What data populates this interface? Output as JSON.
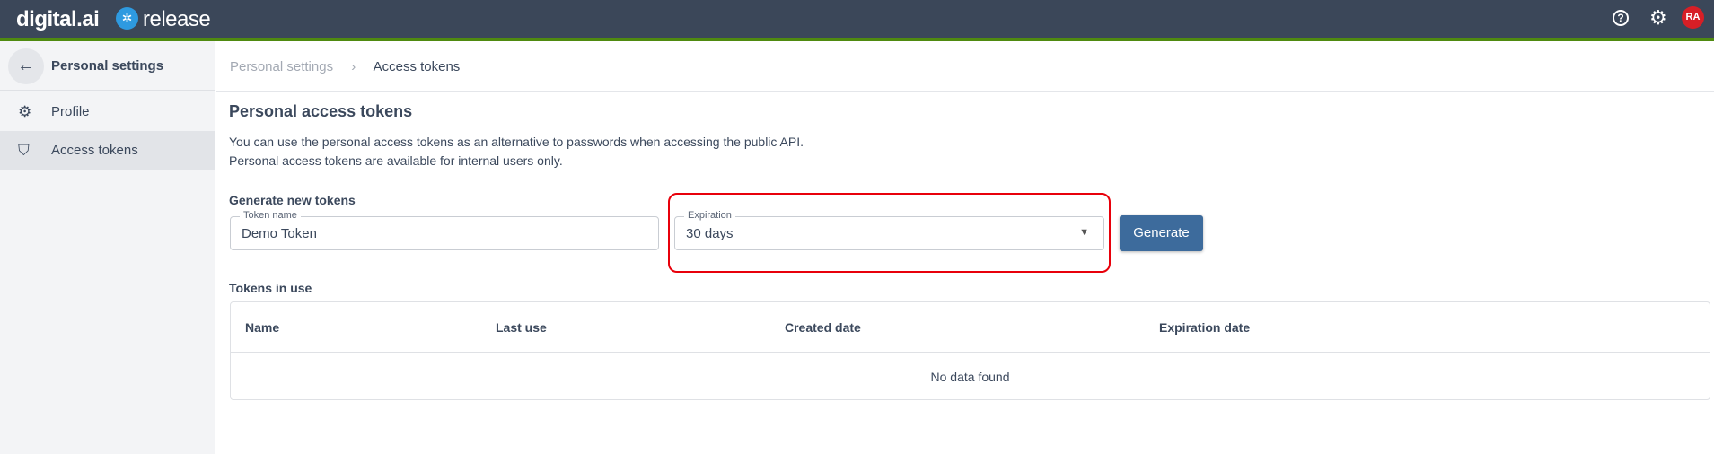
{
  "header": {
    "brand": "digital.ai",
    "product": "release",
    "user_initials": "RA",
    "icons": [
      "help-icon",
      "gear-icon"
    ]
  },
  "sidebar": {
    "title": "Personal settings",
    "items": [
      {
        "label": "Profile",
        "icon": "gear-icon"
      },
      {
        "label": "Access tokens",
        "icon": "shield-user-icon",
        "active": true
      }
    ]
  },
  "breadcrumb": {
    "items": [
      "Personal settings",
      "Access tokens"
    ],
    "separator": "›"
  },
  "main": {
    "title": "Personal access tokens",
    "description": [
      "You can use the personal access tokens as an alternative to passwords when accessing the public API.",
      "Personal access tokens are available for internal users only."
    ],
    "generate": {
      "heading": "Generate new tokens",
      "token_name_label": "Token name",
      "token_name_value": "Demo Token",
      "expiration_label": "Expiration",
      "expiration_value": "30 days",
      "button": "Generate"
    },
    "tokens": {
      "heading": "Tokens in use",
      "columns": [
        "Name",
        "Last use",
        "Created date",
        "Expiration date"
      ],
      "empty": "No data found"
    }
  },
  "colors": {
    "header_bg": "#3b4759",
    "accent_green": "#4f8a10",
    "button": "#3d6b9c",
    "highlight": "#e8000b",
    "avatar": "#d71f26"
  }
}
